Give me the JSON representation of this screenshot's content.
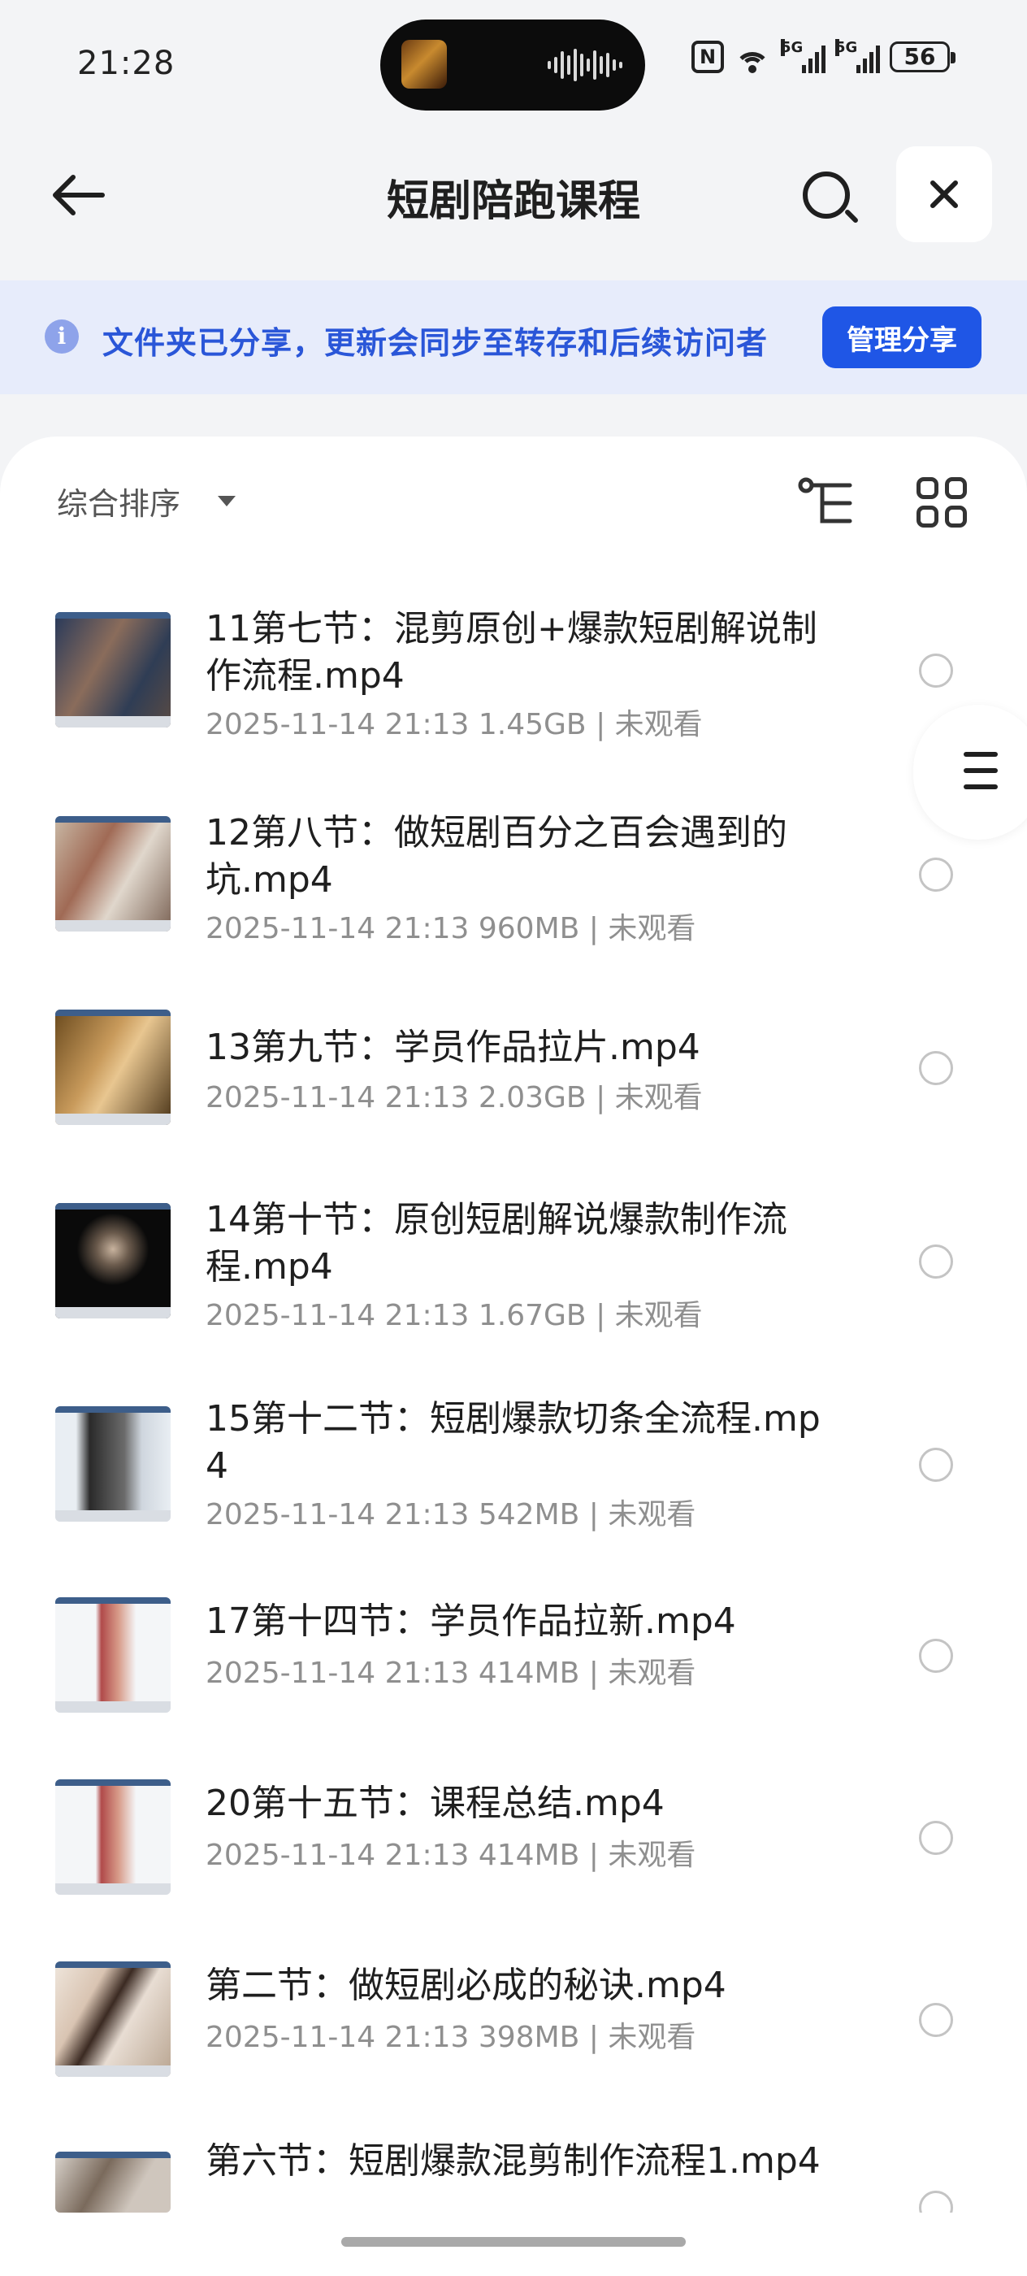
{
  "status_bar": {
    "time": "21:28",
    "nfc_label": "N",
    "signal1_label": "5G",
    "signal2_label": "5G",
    "battery": "56"
  },
  "header": {
    "title": "短剧陪跑课程",
    "back_icon": "arrow-left-icon",
    "search_icon": "search-icon",
    "close_icon": "close-icon"
  },
  "notice": {
    "icon": "info-icon",
    "text": "文件夹已分享，更新会同步至转存和后续访问者",
    "button_label": "管理分享"
  },
  "toolbar": {
    "sort_label": "综合排序"
  },
  "files": [
    {
      "name": "11第七节：混剪原创+爆款短剧解说制作流程.mp4",
      "date": "2025-11-14 21:13",
      "size": "1.45GB",
      "status": "未观看"
    },
    {
      "name": "12第八节：做短剧百分之百会遇到的坑.mp4",
      "date": "2025-11-14 21:13",
      "size": "960MB",
      "status": "未观看"
    },
    {
      "name": "13第九节：学员作品拉片.mp4",
      "date": "2025-11-14 21:13",
      "size": "2.03GB",
      "status": "未观看"
    },
    {
      "name": "14第十节：原创短剧解说爆款制作流程.mp4",
      "date": "2025-11-14 21:13",
      "size": "1.67GB",
      "status": "未观看"
    },
    {
      "name": "15第十二节：短剧爆款切条全流程.mp4",
      "date": "2025-11-14 21:13",
      "size": "542MB",
      "status": "未观看"
    },
    {
      "name": "17第十四节：学员作品拉新.mp4",
      "date": "2025-11-14 21:13",
      "size": "414MB",
      "status": "未观看"
    },
    {
      "name": "20第十五节：课程总结.mp4",
      "date": "2025-11-14 21:13",
      "size": "414MB",
      "status": "未观看"
    },
    {
      "name": "第二节：做短剧必成的秘诀.mp4",
      "date": "2025-11-14 21:13",
      "size": "398MB",
      "status": "未观看"
    },
    {
      "name": "第六节：短剧爆款混剪制作流程1.mp4",
      "date": "",
      "size": "",
      "status": ""
    }
  ],
  "meta_separator": "|"
}
